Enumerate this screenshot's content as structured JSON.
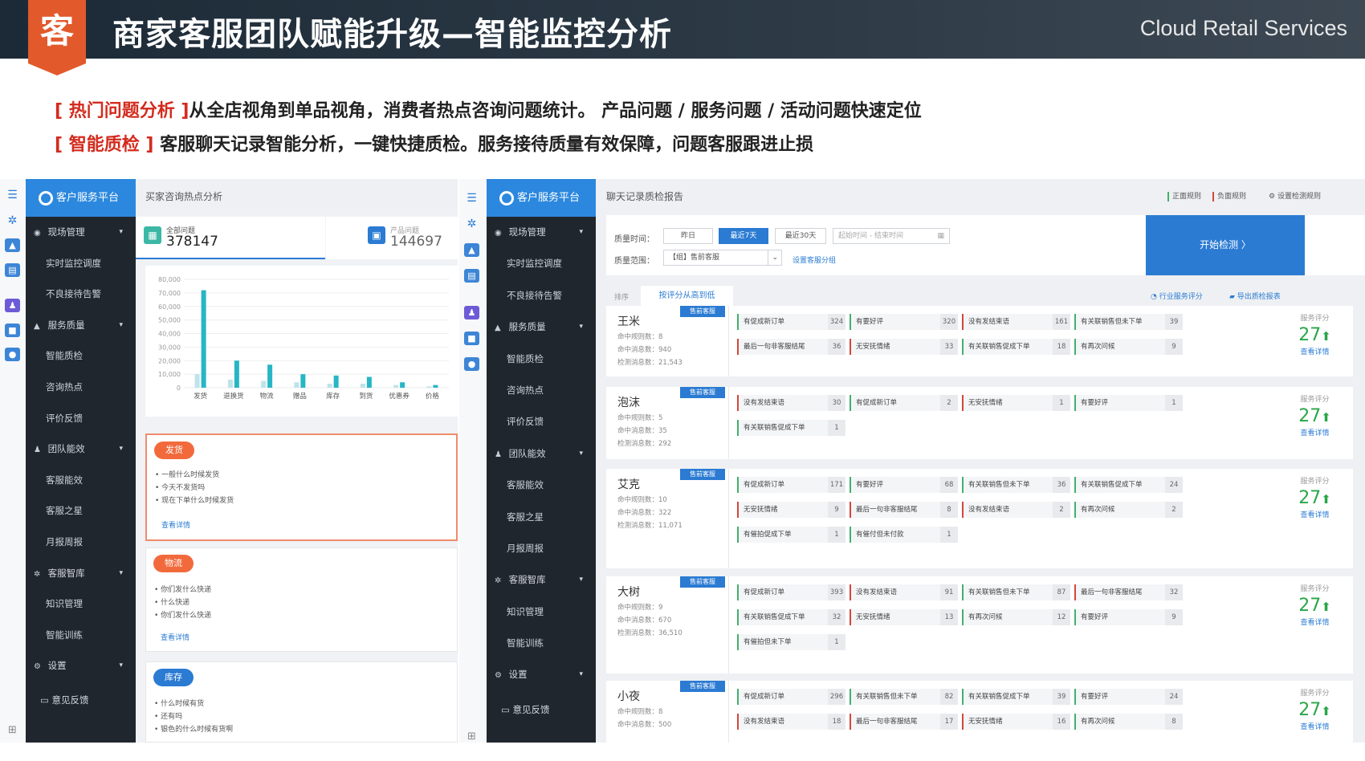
{
  "header": {
    "badge": "客",
    "title": "商家客服团队赋能升级—智能监控分析",
    "brand": "Cloud Retail Services"
  },
  "intro": [
    {
      "tag": "[ 热门问题分析 ]",
      "text": "从全店视角到单品视角，消费者热点咨询问题统计。 产品问题 / 服务问题 / 活动问题快速定位"
    },
    {
      "tag": "[ 智能质检 ]",
      "text": " 客服聊天记录智能分析，一键快捷质检。服务接待质量有效保障，问题客服跟进止损"
    }
  ],
  "sidebar": {
    "brand": "客户服务平台",
    "items": [
      {
        "kind": "grp",
        "icon": "◉",
        "label": "现场管理"
      },
      {
        "kind": "sub",
        "label": "实时监控调度"
      },
      {
        "kind": "sub",
        "label": "不良接待告警"
      },
      {
        "kind": "grp",
        "icon": "▲",
        "label": "服务质量"
      },
      {
        "kind": "sub",
        "label": "智能质检"
      },
      {
        "kind": "sub",
        "label": "咨询热点"
      },
      {
        "kind": "sub",
        "label": "评价反馈"
      },
      {
        "kind": "grp",
        "icon": "♟",
        "label": "团队能效"
      },
      {
        "kind": "sub",
        "label": "客服能效"
      },
      {
        "kind": "sub",
        "label": "客服之星"
      },
      {
        "kind": "sub",
        "label": "月报周报"
      },
      {
        "kind": "grp",
        "icon": "✲",
        "label": "客服智库"
      },
      {
        "kind": "sub",
        "label": "知识管理"
      },
      {
        "kind": "sub",
        "label": "智能训练"
      },
      {
        "kind": "grp",
        "icon": "⚙",
        "label": "设置"
      }
    ],
    "feedback": "意见反馈"
  },
  "hot": {
    "page_title": "买家咨询热点分析",
    "stats": [
      {
        "label": "全部问题",
        "value": "378147",
        "color": "#3bb8a5"
      },
      {
        "label": "产品问题",
        "value": "144697",
        "color": "#2b7bd3"
      }
    ],
    "sections": [
      {
        "label": "发货",
        "color": "#f26a3c",
        "items": [
          "一般什么时候发货",
          "今天不发货吗",
          "现在下单什么时候发货"
        ],
        "link": "查看详情"
      },
      {
        "label": "物流",
        "color": "#f26a3c",
        "items": [
          "你们发什么快递",
          "什么快递",
          "你们发什么快递"
        ],
        "link": "查看详情"
      },
      {
        "label": "库存",
        "color": "#2b7bd3",
        "items": [
          "什么时候有货",
          "还有吗",
          "银色的什么时候有货啊"
        ]
      }
    ]
  },
  "chart_data": {
    "type": "bar",
    "categories": [
      "发货",
      "退换货",
      "物流",
      "赠品",
      "库存",
      "到货",
      "优惠券",
      "价格"
    ],
    "series": [
      {
        "values": [
          72000,
          20000,
          17000,
          10000,
          9000,
          8000,
          4000,
          2000
        ],
        "color": "#27b6c6"
      },
      {
        "values": [
          10000,
          6000,
          5000,
          4000,
          3000,
          3000,
          2000,
          1000
        ],
        "color": "#bfe3ea"
      }
    ],
    "yticks": [
      "80,000",
      "70,000",
      "60,000",
      "50,000",
      "40,000",
      "30,000",
      "20,000",
      "10,000",
      "0"
    ],
    "ylim": [
      0,
      80000
    ],
    "grid": true
  },
  "qc": {
    "page_title": "聊天记录质检报告",
    "links": [
      "正面规则",
      "负面规则",
      "设置检测规则"
    ],
    "time_label": "质量时间：",
    "time_buttons": [
      "昨日",
      "最近7天",
      "最近30天"
    ],
    "start_ph": "起始时间",
    "dash": "-",
    "end_ph": "结束时间",
    "scope_label": "质量范围：",
    "scope_value": "【组】售前客服",
    "scope_link": "设置客服分组",
    "start_button": "开始检测 〉",
    "sort_label": "排序",
    "sort_option": "按评分从高到低",
    "industry": "行业服务评分",
    "export": "导出质检报表",
    "score_label": "服务评分",
    "detail": "查看详情",
    "rows": [
      {
        "name": "王米",
        "tag": "售前客服",
        "meta": [
          "命中规则数：8",
          "命中消息数：940",
          "检测消息数：21,543"
        ],
        "score": "27",
        "cells": [
          [
            "有促成新订单",
            "324",
            "p"
          ],
          [
            "有要好评",
            "320",
            "p"
          ],
          [
            "没有发结束语",
            "161",
            "n"
          ],
          [
            "有关联销售但未下单",
            "39",
            "p"
          ],
          [
            "最后一句非客服结尾",
            "36",
            "n"
          ],
          [
            "无安抚情绪",
            "33",
            "n"
          ],
          [
            "有关联销售促成下单",
            "18",
            "p"
          ],
          [
            "有再次问候",
            "9",
            "p"
          ]
        ]
      },
      {
        "name": "泡沫",
        "tag": "售前客服",
        "meta": [
          "命中规则数：5",
          "命中消息数：35",
          "检测消息数：292"
        ],
        "score": "27",
        "cells": [
          [
            "没有发结束语",
            "30",
            "n"
          ],
          [
            "有促成新订单",
            "2",
            "p"
          ],
          [
            "无安抚情绪",
            "1",
            "n"
          ],
          [
            "有要好评",
            "1",
            "p"
          ],
          [
            "有关联销售促成下单",
            "1",
            "p"
          ]
        ]
      },
      {
        "name": "艾克",
        "tag": "售前客服",
        "meta": [
          "命中规则数：10",
          "命中消息数：322",
          "检测消息数：11,071"
        ],
        "score": "27",
        "cells": [
          [
            "有促成新订单",
            "171",
            "p"
          ],
          [
            "有要好评",
            "68",
            "p"
          ],
          [
            "有关联销售但未下单",
            "36",
            "p"
          ],
          [
            "有关联销售促成下单",
            "24",
            "p"
          ],
          [
            "无安抚情绪",
            "9",
            "n"
          ],
          [
            "最后一句非客服结尾",
            "8",
            "n"
          ],
          [
            "没有发结束语",
            "2",
            "n"
          ],
          [
            "有再次问候",
            "2",
            "p"
          ],
          [
            "有催拍促成下单",
            "1",
            "p"
          ],
          [
            "有催付但未付款",
            "1",
            "p"
          ]
        ]
      },
      {
        "name": "大树",
        "tag": "售前客服",
        "meta": [
          "命中规则数：9",
          "命中消息数：670",
          "检测消息数：36,510"
        ],
        "score": "27",
        "cells": [
          [
            "有促成新订单",
            "393",
            "p"
          ],
          [
            "没有发结束语",
            "91",
            "n"
          ],
          [
            "有关联销售但未下单",
            "87",
            "p"
          ],
          [
            "最后一句非客服结尾",
            "32",
            "n"
          ],
          [
            "有关联销售促成下单",
            "32",
            "p"
          ],
          [
            "无安抚情绪",
            "13",
            "n"
          ],
          [
            "有再次问候",
            "12",
            "p"
          ],
          [
            "有要好评",
            "9",
            "p"
          ],
          [
            "有催拍但未下单",
            "1",
            "p"
          ]
        ]
      },
      {
        "name": "小夜",
        "tag": "售前客服",
        "meta": [
          "命中规则数：8",
          "命中消息数：500"
        ],
        "score": "27",
        "cells": [
          [
            "有促成新订单",
            "296",
            "p"
          ],
          [
            "有关联销售但未下单",
            "82",
            "p"
          ],
          [
            "有关联销售促成下单",
            "39",
            "p"
          ],
          [
            "有要好评",
            "24",
            "p"
          ],
          [
            "没有发结束语",
            "18",
            "n"
          ],
          [
            "最后一句非客服结尾",
            "17",
            "n"
          ],
          [
            "无安抚情绪",
            "16",
            "n"
          ],
          [
            "有再次问候",
            "8",
            "p"
          ]
        ]
      }
    ]
  }
}
